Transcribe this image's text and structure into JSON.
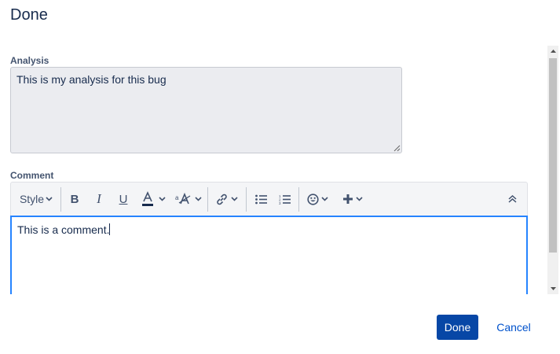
{
  "dialog": {
    "title": "Done"
  },
  "analysis": {
    "label": "Analysis",
    "value": "This is my analysis for this bug"
  },
  "comment": {
    "label": "Comment",
    "value": "This is a comment.",
    "toolbar": {
      "style_label": "Style",
      "icons": [
        "bold-icon",
        "italic-icon",
        "underline-icon",
        "text-color-icon",
        "text-styles-icon",
        "link-icon",
        "bullet-list-icon",
        "numbered-list-icon",
        "emoji-icon",
        "insert-plus-icon",
        "collapse-toolbar-icon"
      ]
    }
  },
  "footer": {
    "done_label": "Done",
    "cancel_label": "Cancel"
  },
  "colors": {
    "primary": "#0747a6",
    "focus_border": "#2684ff",
    "link": "#0052cc",
    "field_background": "#ebecf0"
  }
}
